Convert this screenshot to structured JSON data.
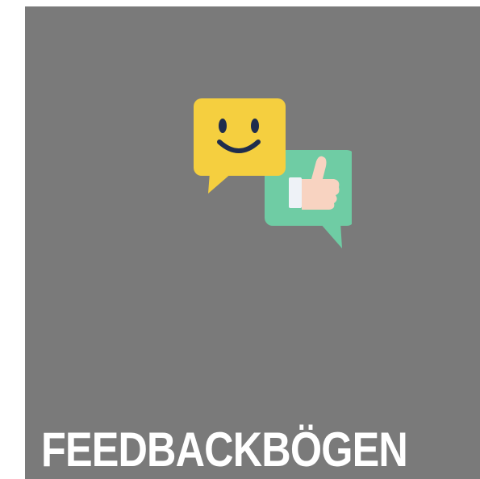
{
  "tile": {
    "label": "FEEDBACKBÖGEN",
    "background_color": "#7a7a7a",
    "label_color": "#ffffff",
    "icon": "feedback-speech-bubbles-icon",
    "icon_parts": [
      "smiley-face-icon",
      "thumbs-up-icon"
    ],
    "icon_colors": {
      "smiley_bubble": "#f5cf3f",
      "thumbs_bubble": "#6fcca4",
      "thumb": "#f8d3c1",
      "face_features": "#1f2d4d"
    }
  }
}
